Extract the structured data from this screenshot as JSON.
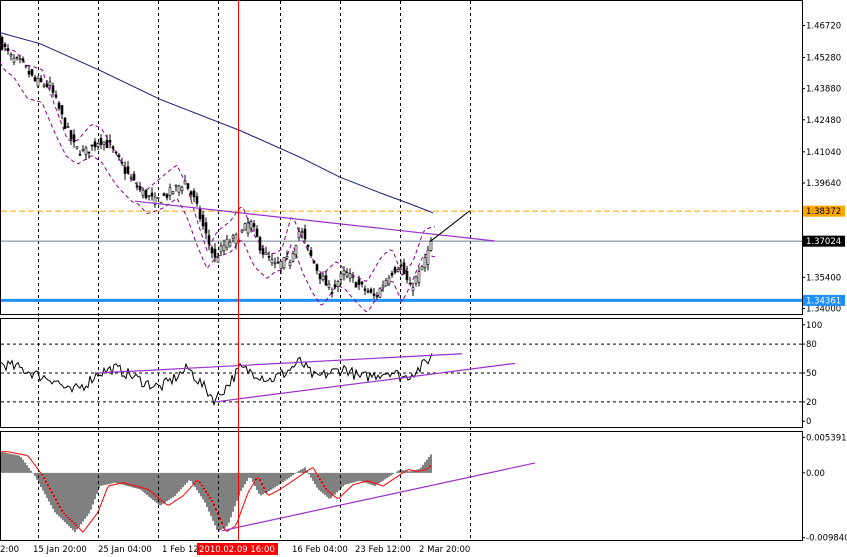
{
  "price_axis": {
    "ticks": [
      {
        "label": "1.46720",
        "value": 1.4672
      },
      {
        "label": "1.45280",
        "value": 1.4528
      },
      {
        "label": "1.43880",
        "value": 1.4388
      },
      {
        "label": "1.42480",
        "value": 1.4248
      },
      {
        "label": "1.41040",
        "value": 1.4104
      },
      {
        "label": "1.39640",
        "value": 1.3964
      },
      {
        "label": "1.35400",
        "value": 1.354
      },
      {
        "label": "1.34000",
        "value": 1.34
      }
    ],
    "hidden_ticks": [
      "1.38240",
      "1.36800"
    ],
    "range": [
      1.3375,
      1.4782
    ]
  },
  "price_labels": [
    {
      "label": "1.38372",
      "value": 1.38372,
      "bg": "#ffa500",
      "fg": "#000000"
    },
    {
      "label": "1.37024",
      "value": 1.37024,
      "bg": "#000000",
      "fg": "#ffffff"
    },
    {
      "label": "1.34361",
      "value": 1.34361,
      "bg": "#1e90ff",
      "fg": "#ffffff"
    }
  ],
  "oscillator_axis": {
    "ticks": [
      {
        "label": "100",
        "value": 100
      },
      {
        "label": "80",
        "value": 80
      },
      {
        "label": "50",
        "value": 50
      },
      {
        "label": "20",
        "value": 20
      },
      {
        "label": "0",
        "value": 0
      }
    ],
    "range": [
      -6,
      106
    ],
    "levels": [
      80,
      50,
      20
    ]
  },
  "histogram_axis": {
    "ticks": [
      {
        "label": "0.005391",
        "value": 0.005391
      },
      {
        "label": "0.00",
        "value": 0
      },
      {
        "label": "-0.009840",
        "value": -0.00984
      }
    ],
    "range": [
      -0.0102,
      0.0062
    ]
  },
  "time_axis": {
    "labels": [
      "2:00",
      "15 Jan 20:00",
      "25 Jan 04:00",
      "1 Feb 12",
      "16 Feb 04:00",
      "23 Feb 12:00",
      "2 Mar 20:00"
    ],
    "highlight": {
      "label": "2010.02.09 16:00",
      "bg": "#ff0000",
      "fg": "#ffffff"
    }
  },
  "colors": {
    "candles": "#000000",
    "moving_average": "#191970",
    "envelope": "#8b008b",
    "trendline": "#9932cc",
    "grid": "#000000",
    "crosshair": "#ff0000",
    "support_line": "#1e90ff",
    "resistance_line": "#ffa500",
    "signal_line": "#ff0000",
    "histogram": "#000000"
  },
  "chart_data": {
    "type": "candlestick",
    "panels": [
      {
        "name": "price",
        "type": "candlestick",
        "y_range": [
          1.3375,
          1.4782
        ],
        "overlays": [
          "moving average",
          "envelope bands",
          "trendlines"
        ],
        "horizontal_levels": [
          1.38372,
          1.37024,
          1.34361
        ]
      },
      {
        "name": "oscillator",
        "type": "line",
        "y_range": [
          0,
          100
        ],
        "levels": [
          80,
          50,
          20
        ]
      },
      {
        "name": "histogram",
        "type": "bar",
        "y_range": [
          -0.00984,
          0.005391
        ],
        "signal_line": true
      }
    ],
    "x_labels": [
      "2:00",
      "15 Jan 20:00",
      "25 Jan 04:00",
      "1 Feb 12",
      "2010.02.09 16:00",
      "16 Feb 04:00",
      "23 Feb 12:00",
      "2 Mar 20:00"
    ],
    "grid": true
  }
}
